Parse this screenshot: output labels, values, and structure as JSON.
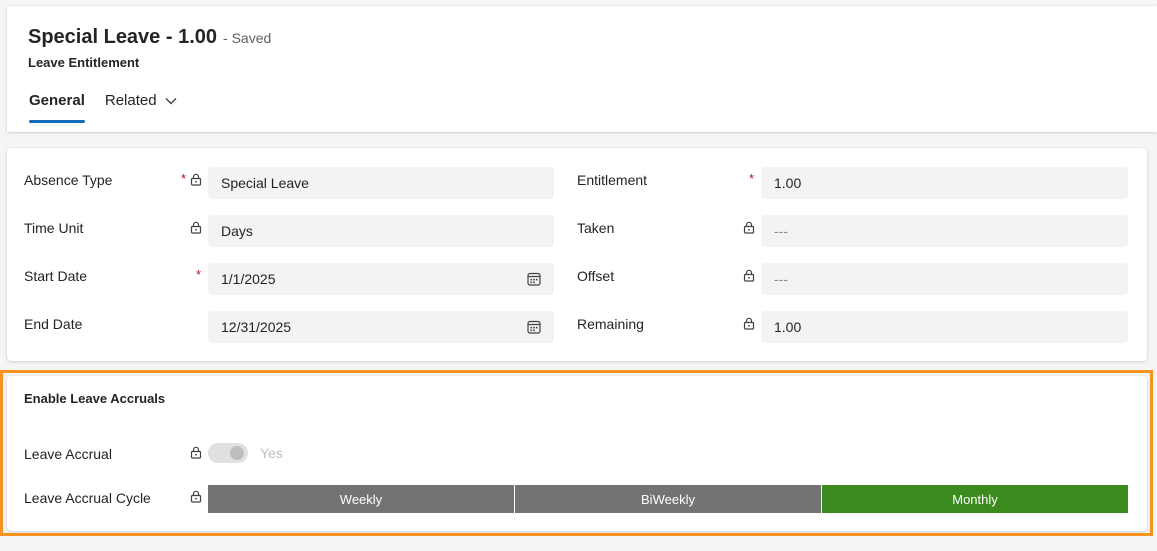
{
  "header": {
    "title": "Special Leave - 1.00",
    "saved_status": "- Saved",
    "entity": "Leave Entitlement",
    "tabs": [
      {
        "label": "General",
        "active": true
      },
      {
        "label": "Related",
        "active": false
      }
    ]
  },
  "fields": {
    "absence_type": {
      "label": "Absence Type",
      "value": "Special Leave",
      "required": "*"
    },
    "time_unit": {
      "label": "Time Unit",
      "value": "Days"
    },
    "start_date": {
      "label": "Start Date",
      "value": "1/1/2025",
      "required": "*"
    },
    "end_date": {
      "label": "End Date",
      "value": "12/31/2025"
    },
    "entitlement": {
      "label": "Entitlement",
      "value": "1.00",
      "required": "*"
    },
    "taken": {
      "label": "Taken",
      "value": "---"
    },
    "offset": {
      "label": "Offset",
      "value": "---"
    },
    "remaining": {
      "label": "Remaining",
      "value": "1.00"
    }
  },
  "accruals": {
    "section_title": "Enable Leave Accruals",
    "leave_accrual": {
      "label": "Leave Accrual",
      "value": "Yes"
    },
    "accrual_cycle": {
      "label": "Leave Accrual Cycle",
      "options": [
        "Weekly",
        "BiWeekly",
        "Monthly"
      ],
      "selected": "Monthly"
    }
  },
  "colors": {
    "accent": "#0f6cbd",
    "required": "#c50f1f",
    "highlight_border": "#f7931e",
    "selected_option": "#3a8a1e",
    "option": "#737373"
  }
}
